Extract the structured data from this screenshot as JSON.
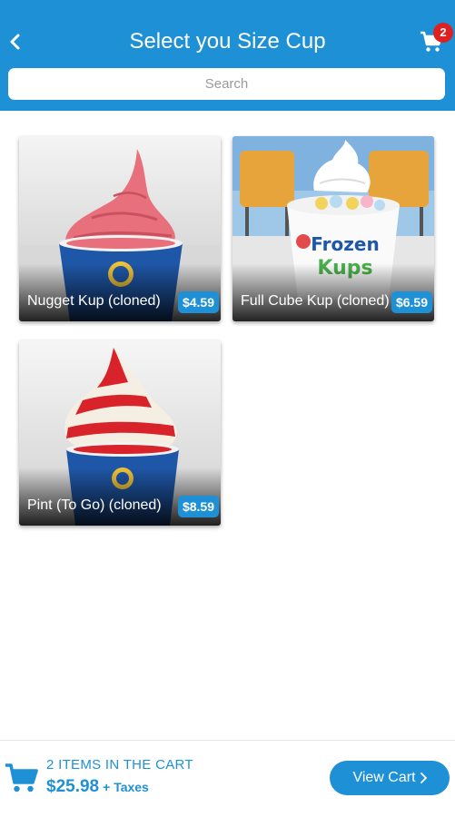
{
  "header": {
    "title": "Select you Size Cup",
    "back_icon": "chevron-left-icon",
    "cart_icon": "shopping-cart-icon",
    "cart_badge": "2"
  },
  "search": {
    "placeholder": "Search"
  },
  "products": [
    {
      "name": "Nugget Kup (cloned)",
      "price": "$4.59"
    },
    {
      "name": "Full Cube Kup (cloned)",
      "price": "$6.59"
    },
    {
      "name": "Pint (To Go) (cloned)",
      "price": "$8.59"
    }
  ],
  "footer": {
    "cart_icon": "shopping-cart-icon",
    "items_label": "2 ITEMS IN THE CART",
    "total": "$25.98",
    "taxes_label": "+ Taxes",
    "view_cart_label": "View Cart",
    "view_cart_icon": "chevron-right-icon"
  },
  "colors": {
    "accent": "#1e90d6",
    "badge": "#e02020"
  }
}
